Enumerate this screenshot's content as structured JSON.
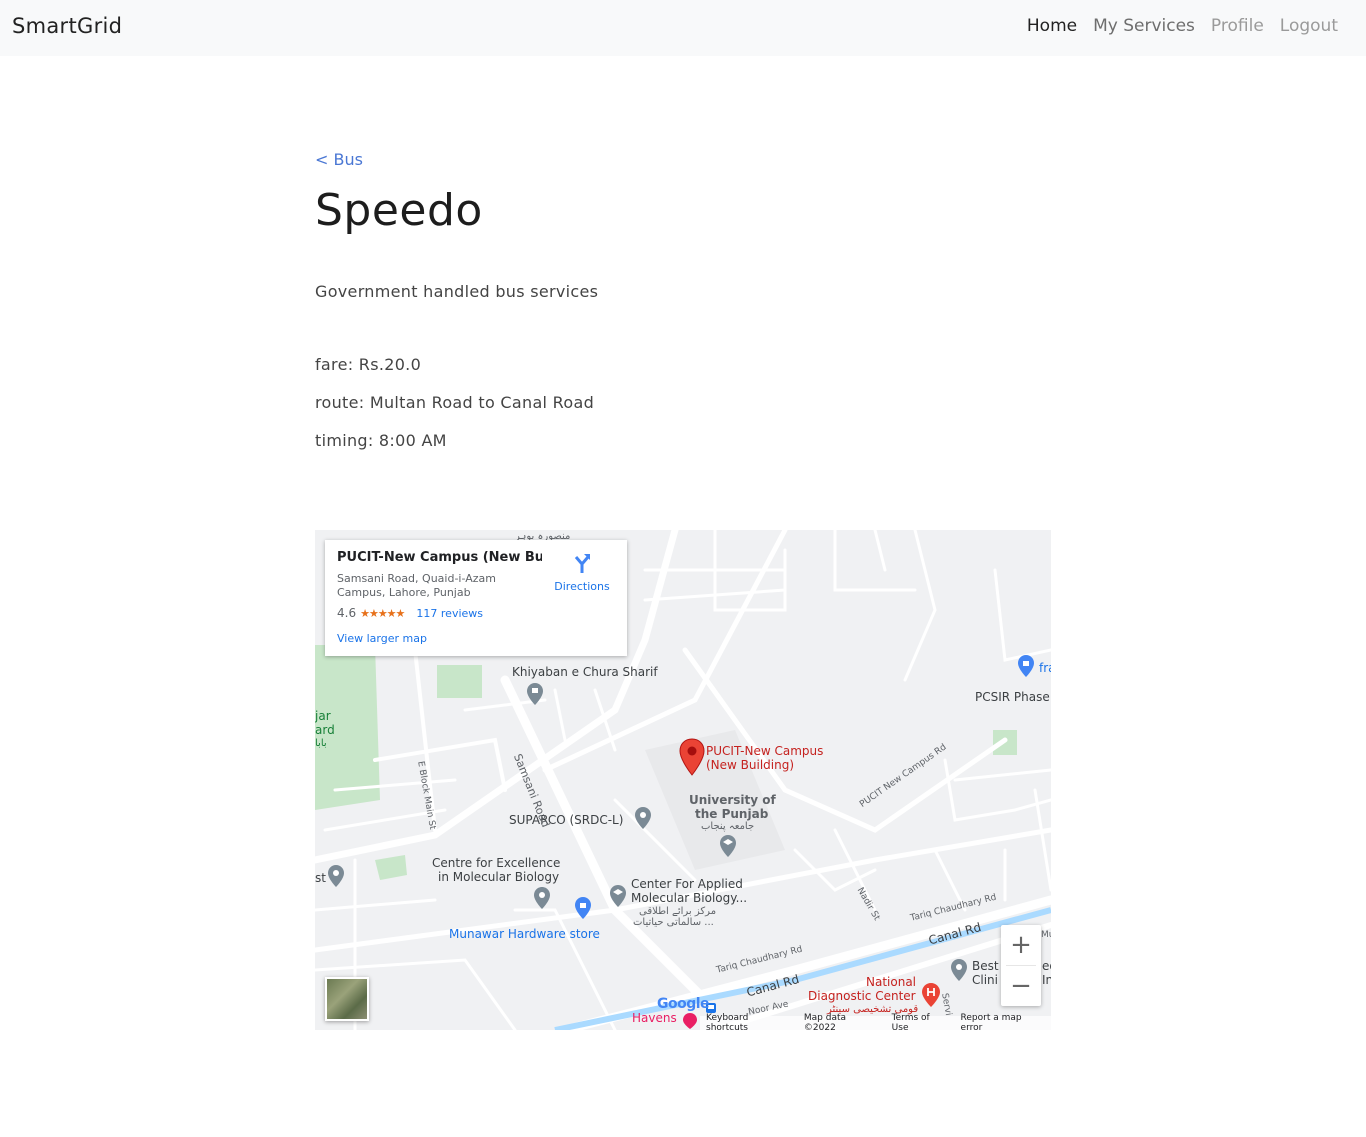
{
  "navbar": {
    "brand": "SmartGrid",
    "links": [
      {
        "label": "Home"
      },
      {
        "label": "My Services"
      },
      {
        "label": "Profile"
      },
      {
        "label": "Logout"
      }
    ]
  },
  "main": {
    "back_link": "< Bus",
    "title": "Speedo",
    "description": "Government handled bus services",
    "fare": "fare: Rs.20.0",
    "route": "route: Multan Road to Canal Road",
    "timing": "timing: 8:00 AM"
  },
  "map": {
    "card": {
      "title": "PUCIT-New Campus (New Buil...",
      "address": "Samsani Road, Quaid-i-Azam Campus, Lahore, Punjab",
      "rating": "4.6",
      "stars": "★★★★★",
      "reviews": "117 reviews",
      "larger_map": "View larger map",
      "directions": "Directions"
    },
    "labels": {
      "khiyaban": "Khiyaban e Chura Sharif",
      "pucit_main_1": "PUCIT-New Campus",
      "pucit_main_2": "(New Building)",
      "university_1": "University of",
      "university_2": "the Punjab",
      "university_urdu": "جامعہ پنجاب",
      "suparco": "SUPARCO (SRDC-L)",
      "centre_1": "Centre for Excellence",
      "centre_2": "in Molecular Biology",
      "applied_1": "Center For Applied",
      "applied_2": "Molecular Biology...",
      "applied_urdu_1": "مرکز برائے اطلاقی",
      "applied_urdu_2": "سالماتی حیاتیات ...",
      "munawar": "Munawar Hardware store",
      "pcsir": "PCSIR Phase",
      "samsani": "Samsani Road",
      "eblock": "E Block Main St",
      "pucit_rd": "PUCIT New Campus Rd",
      "nadir": "Nadir St",
      "tariq_1": "Tariq Chaudhary Rd",
      "tariq_2": "Tariq Chaudhary Rd",
      "canal_1": "Canal Rd",
      "canal_2": "Canal Rd",
      "noor": "Noor Ave",
      "national_1": "National",
      "national_2": "Diagnostic Center",
      "national_urdu": "قومی تشخیصی سینٹر",
      "best_1": "Best",
      "best_2": "Clini",
      "havens": "Havens",
      "urdu_top": "منصورہ بوہر",
      "fra": "fra",
      "jar_1": "jar",
      "jar_2": "ard",
      "jar_3": "بابا",
      "st_left": "st",
      "mu": "Mu",
      "ed": "ed",
      "in": "In",
      "servi": "Servi"
    },
    "google": "Google",
    "zoom_in": "+",
    "zoom_out": "−",
    "attribution": {
      "shortcuts": "Keyboard shortcuts",
      "data": "Map data ©2022",
      "terms": "Terms of Use",
      "report": "Report a map error"
    }
  },
  "colors": {
    "link_blue": "#4a77d4",
    "map_bg": "#f0f1f3",
    "park_green": "#c8e6c9",
    "pin_red": "#ea4335",
    "canal_blue": "#aadaff"
  }
}
